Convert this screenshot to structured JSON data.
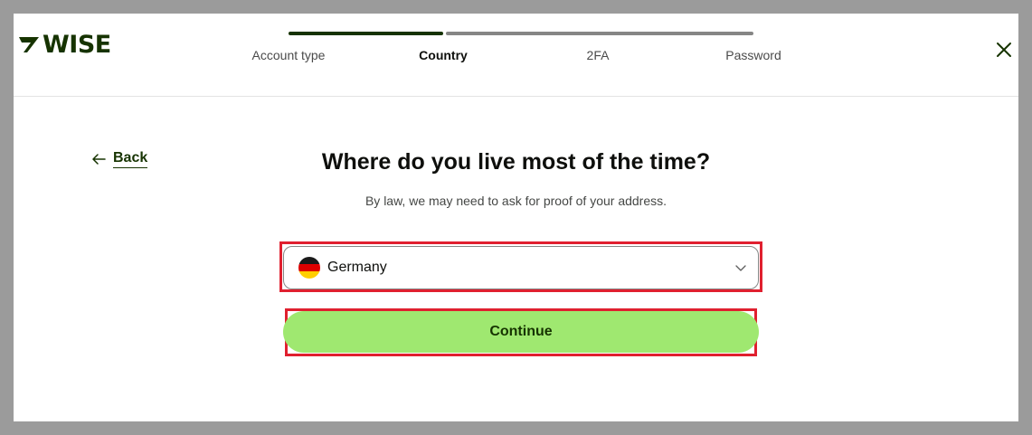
{
  "brand": {
    "logo_text": "WISE",
    "color": "#163300",
    "accent": "#9fe870"
  },
  "stepper": {
    "steps": [
      {
        "label": "Account type",
        "state": "complete"
      },
      {
        "label": "Country",
        "state": "active"
      },
      {
        "label": "2FA",
        "state": "pending"
      },
      {
        "label": "Password",
        "state": "pending"
      }
    ]
  },
  "header": {
    "close_icon": "close-icon"
  },
  "nav": {
    "back_label": "Back",
    "back_icon": "arrow-left-icon"
  },
  "main": {
    "title": "Where do you live most of the time?",
    "subtitle": "By law, we may need to ask for proof of your address."
  },
  "country_select": {
    "value": "Germany",
    "flag_icon": "germany-flag-icon",
    "chevron_icon": "chevron-down-icon"
  },
  "actions": {
    "continue_label": "Continue"
  }
}
